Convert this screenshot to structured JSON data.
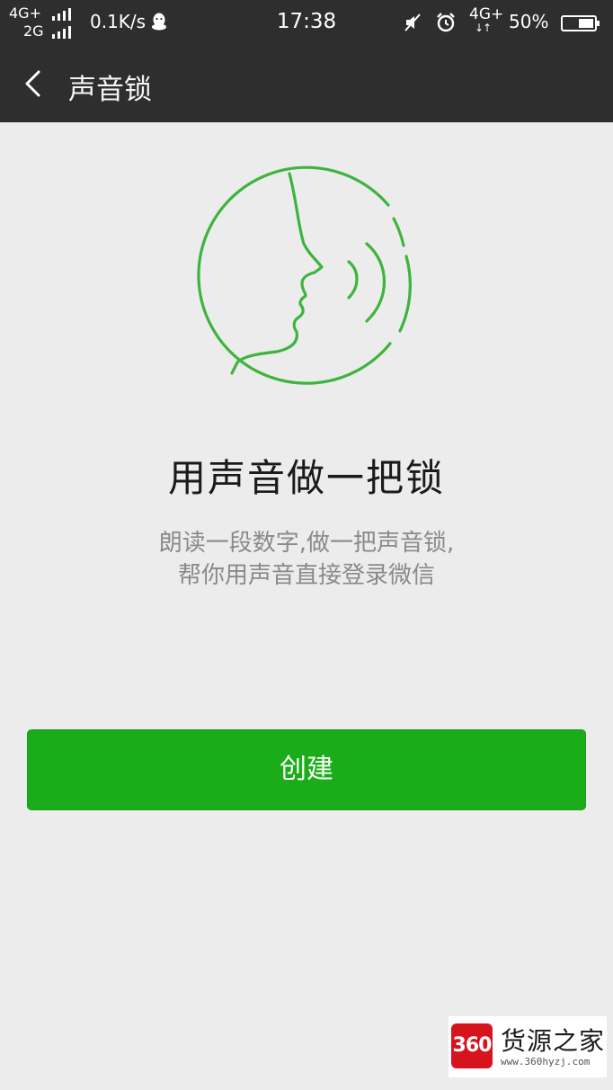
{
  "status_bar": {
    "network_line1": "4G+",
    "network_line2": "2G",
    "speed": "0.1K/s",
    "time": "17:38",
    "network_right": "4G+",
    "data_arrows": "↓↑",
    "battery": "50%",
    "battery_level": 0.5
  },
  "title_bar": {
    "title": "声音锁"
  },
  "main": {
    "headline": "用声音做一把锁",
    "desc_line1": "朗读一段数字,做一把声音锁,",
    "desc_line2": "帮你用声音直接登录微信",
    "create_label": "创建"
  },
  "watermark": {
    "logo_text": "360",
    "name": "货源之家",
    "url": "www.360hyzj.com"
  },
  "colors": {
    "bar_background": "#2e2e2e",
    "page_background": "#ececec",
    "accent_green": "#1aad19",
    "illustration_green": "#3db43d"
  },
  "icons": [
    "back-arrow-icon",
    "qq-icon",
    "signal-icon",
    "mute-icon",
    "alarm-icon",
    "battery-icon",
    "voice-face-icon"
  ]
}
